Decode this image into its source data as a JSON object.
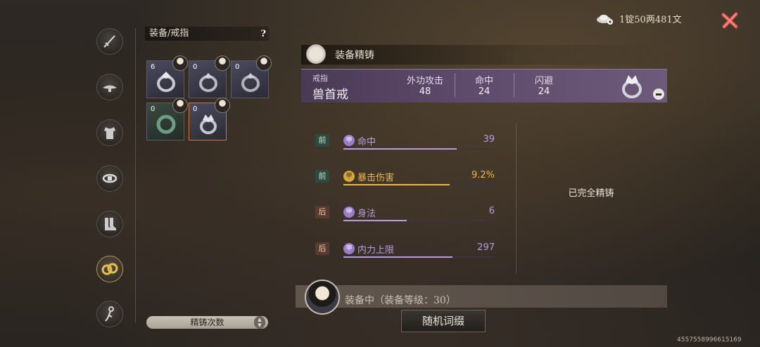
{
  "currency": {
    "icon": "silver-ingot-icon",
    "amount": "1锭50两481文"
  },
  "close": {
    "icon": "close-icon"
  },
  "categories": [
    {
      "name": "weapon",
      "icon": "sword-icon",
      "active": false
    },
    {
      "name": "hat",
      "icon": "hat-icon",
      "active": false
    },
    {
      "name": "armor",
      "icon": "armor-icon",
      "active": false
    },
    {
      "name": "belt",
      "icon": "belt-icon",
      "active": false
    },
    {
      "name": "boots",
      "icon": "boots-icon",
      "active": false
    },
    {
      "name": "ring",
      "icon": "ring-icon",
      "active": true
    },
    {
      "name": "accessory",
      "icon": "accessory-icon",
      "active": false
    }
  ],
  "inventory": {
    "title": "装备/戒指",
    "help": "?",
    "slots": [
      {
        "count": "6",
        "type": "silver-ring",
        "selected": false
      },
      {
        "count": "0",
        "type": "silver-ring",
        "selected": false
      },
      {
        "count": "0",
        "type": "silver-ring",
        "selected": false
      },
      {
        "count": "0",
        "type": "jade-ring",
        "selected": false
      },
      {
        "count": "0",
        "type": "beast-ring",
        "selected": true
      }
    ],
    "sort_label": "精铸次数"
  },
  "section": {
    "title": "装备精铸"
  },
  "item": {
    "type": "戒指",
    "name": "兽首戒",
    "stats": [
      {
        "label": "外功攻击",
        "value": "48"
      },
      {
        "label": "命中",
        "value": "24"
      },
      {
        "label": "闪避",
        "value": "24"
      }
    ]
  },
  "affixes": [
    {
      "tag": "前",
      "tag_kind": "front",
      "coin": "甲",
      "coin_kind": "purple",
      "name": "命中",
      "value": "39",
      "color": "#b79ce0",
      "fill": 0.75
    },
    {
      "tag": "前",
      "tag_kind": "front",
      "coin": "甲",
      "coin_kind": "gold",
      "name": "暴击伤害",
      "value": "9.2%",
      "color": "#e6b850",
      "fill": 0.7
    },
    {
      "tag": "后",
      "tag_kind": "back",
      "coin": "甲",
      "coin_kind": "purple",
      "name": "身法",
      "value": "6",
      "color": "#b79ce0",
      "fill": 0.42
    },
    {
      "tag": "后",
      "tag_kind": "back",
      "coin": "甲",
      "coin_kind": "purple",
      "name": "内力上限",
      "value": "297",
      "color": "#b79ce0",
      "fill": 0.72
    }
  ],
  "refine_status": "已完全精铸",
  "equipped": {
    "text": "装备中（装备等级：30）"
  },
  "random_button": "随机词缀",
  "uid": "4557558996615169"
}
